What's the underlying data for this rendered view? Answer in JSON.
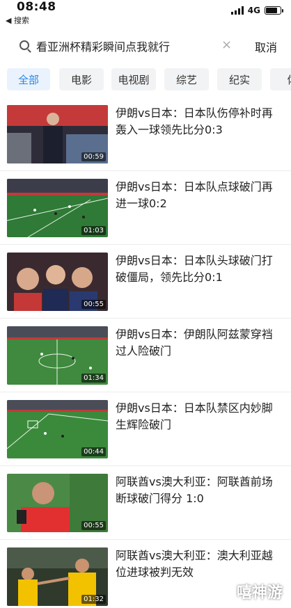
{
  "status_bar": {
    "time": "08:48",
    "back_label": "◀ 搜索",
    "network": "4G"
  },
  "search": {
    "query": "看亚洲杯精彩瞬间点我就行",
    "clear_icon": "close-icon",
    "cancel_label": "取消"
  },
  "tabs": [
    {
      "label": "全部",
      "active": true
    },
    {
      "label": "电影",
      "active": false
    },
    {
      "label": "电视剧",
      "active": false
    },
    {
      "label": "综艺",
      "active": false
    },
    {
      "label": "纪实",
      "active": false
    },
    {
      "label": "体",
      "active": false
    }
  ],
  "results": [
    {
      "title": "伊朗vs日本：日本队伤停补时再轰入一球领先比分0:3",
      "duration": "00:59"
    },
    {
      "title": "伊朗vs日本：日本队点球破门再进一球0:2",
      "duration": "01:03"
    },
    {
      "title": "伊朗vs日本：日本队头球破门打破僵局，领先比分0:1",
      "duration": "00:55"
    },
    {
      "title": "伊朗vs日本：伊朗队阿兹蒙穿裆过人险破门",
      "duration": "01:34"
    },
    {
      "title": "伊朗vs日本：日本队禁区内妙脚生辉险破门",
      "duration": "00:44"
    },
    {
      "title": "阿联酋vs澳大利亚：阿联酋前场断球破门得分 1:0",
      "duration": "00:55"
    },
    {
      "title": "阿联酋vs澳大利亚：澳大利亚越位进球被判无效",
      "duration": "01:32"
    }
  ],
  "watermark": "嘻神游",
  "colors": {
    "accent": "#2a86e0",
    "tab_bg": "#f2f3f5",
    "active_tab_bg": "#eaf3fd"
  }
}
